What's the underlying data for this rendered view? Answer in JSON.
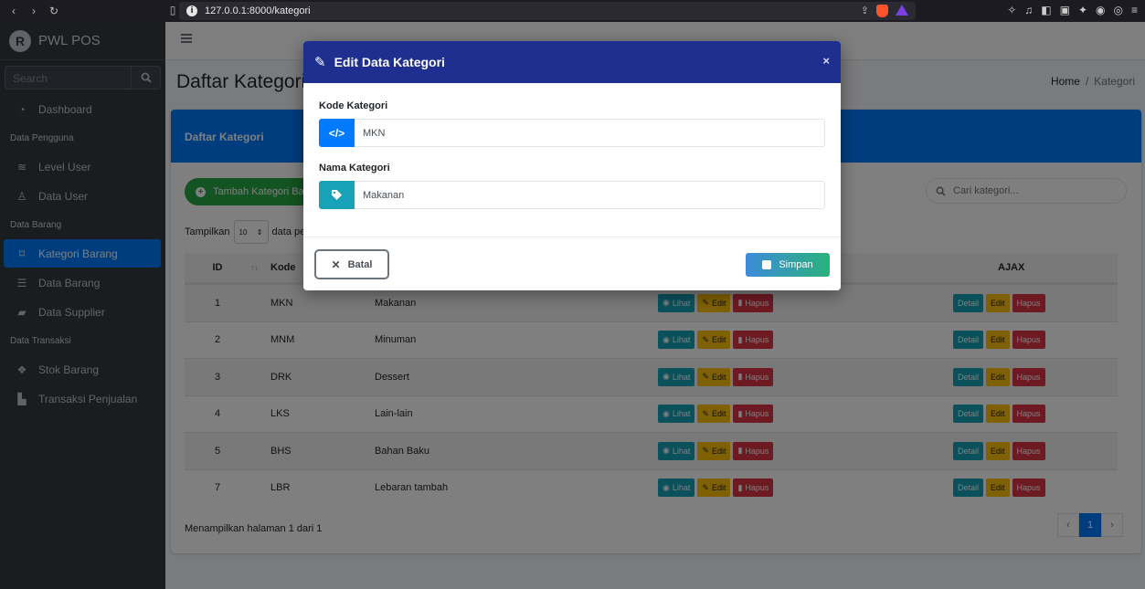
{
  "browser": {
    "url": "127.0.0.1:8000/kategori",
    "info_icon": "i"
  },
  "sidebar": {
    "brand": "PWL POS",
    "search_placeholder": "Search",
    "items": [
      {
        "type": "item",
        "label": "Dashboard",
        "icon": "tachometer-icon"
      },
      {
        "type": "header",
        "label": "Data Pengguna"
      },
      {
        "type": "item",
        "label": "Level User",
        "icon": "layers-icon"
      },
      {
        "type": "item",
        "label": "Data User",
        "icon": "user-icon"
      },
      {
        "type": "header",
        "label": "Data Barang"
      },
      {
        "type": "item",
        "label": "Kategori Barang",
        "icon": "bookmark-icon",
        "active": true
      },
      {
        "type": "item",
        "label": "Data Barang",
        "icon": "list-icon"
      },
      {
        "type": "item",
        "label": "Data Supplier",
        "icon": "truck-icon"
      },
      {
        "type": "header",
        "label": "Data Transaksi"
      },
      {
        "type": "item",
        "label": "Stok Barang",
        "icon": "cubes-icon"
      },
      {
        "type": "item",
        "label": "Transaksi Penjualan",
        "icon": "cash-register-icon"
      }
    ]
  },
  "header": {
    "page_title": "Daftar Kategori",
    "breadcrumb_home": "Home",
    "breadcrumb_sep": "/",
    "breadcrumb_current": "Kategori"
  },
  "card": {
    "title": "Daftar Kategori",
    "add_button": "Tambah Kategori Ba",
    "search_placeholder": "Cari kategori...",
    "show_label": "Tampilkan",
    "page_length": "10",
    "show_suffix": "data pe",
    "columns": {
      "id": "ID",
      "kode": "Kode",
      "ajax": "AJAX"
    },
    "rows": [
      {
        "id": "1",
        "kode": "MKN",
        "nama": "Makanan"
      },
      {
        "id": "2",
        "kode": "MNM",
        "nama": "Minuman"
      },
      {
        "id": "3",
        "kode": "DRK",
        "nama": "Dessert"
      },
      {
        "id": "4",
        "kode": "LKS",
        "nama": "Lain-lain"
      },
      {
        "id": "5",
        "kode": "BHS",
        "nama": "Bahan Baku"
      },
      {
        "id": "7",
        "kode": "LBR",
        "nama": "Lebaran tambah"
      }
    ],
    "row_buttons": {
      "lihat": "Lihat",
      "edit": "Edit",
      "hapus": "Hapus",
      "detail": "Detail"
    },
    "footer_info": "Menampilkan halaman 1 dari 1",
    "pagination": {
      "prev": "‹",
      "current": "1",
      "next": "›"
    }
  },
  "modal": {
    "title": "Edit Data Kategori",
    "close": "×",
    "kode_label": "Kode Kategori",
    "kode_value": "MKN",
    "nama_label": "Nama Kategori",
    "nama_value": "Makanan",
    "cancel": "Batal",
    "save": "Simpan"
  },
  "colors": {
    "primary": "#007bff",
    "modal_header": "#1f2f8f",
    "sidebar": "#343a40",
    "success": "#28a745",
    "info": "#17a2b8",
    "warning": "#ffc107",
    "danger": "#dc3545"
  }
}
